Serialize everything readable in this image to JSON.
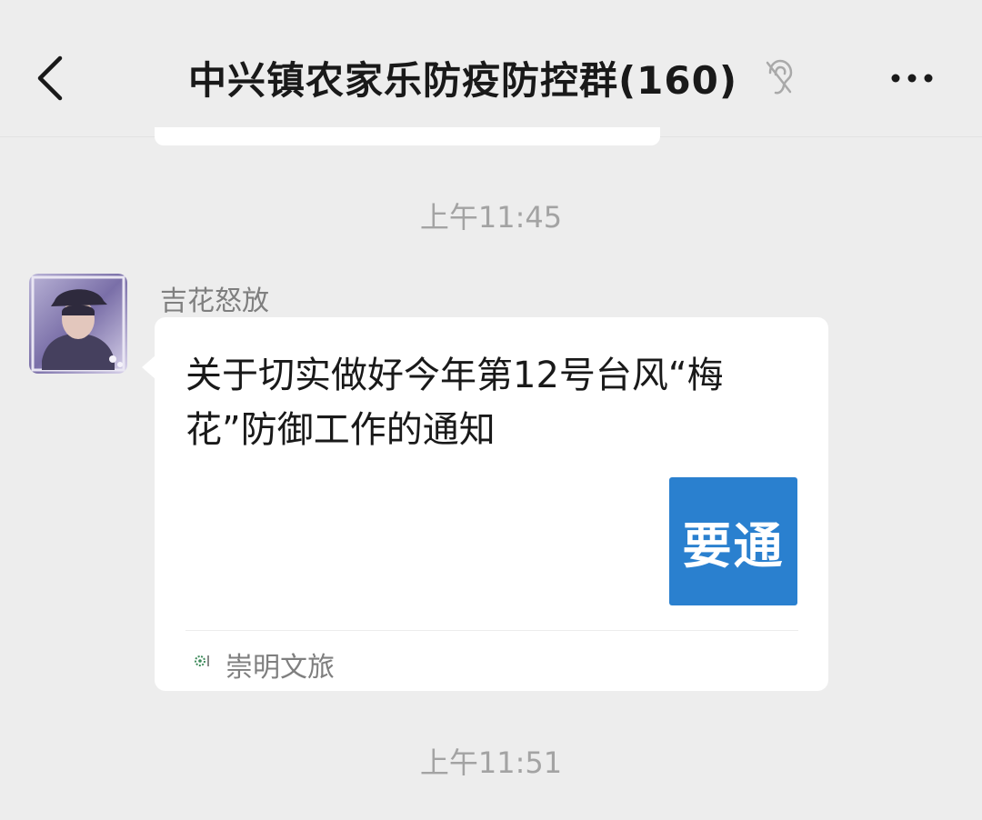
{
  "header": {
    "title": "中兴镇农家乐防疫防控群(160)",
    "back_icon": "chevron-left-icon",
    "mute_icon": "ear-icon",
    "more_icon": "more-horizontal-icon"
  },
  "messages": [
    {
      "type": "timestamp",
      "text": "上午11:45"
    },
    {
      "type": "link_card",
      "sender": "吉花怒放",
      "title": "关于切实做好今年第12号台风“梅花”防御工作的通知",
      "thumbnail_text": "要通",
      "source_name": "崇明文旅"
    },
    {
      "type": "timestamp",
      "text": "上午11:51"
    }
  ],
  "colors": {
    "background": "#ededed",
    "bubble": "#ffffff",
    "thumbnail": "#2a80cf",
    "secondary_text": "#7f7f7f"
  }
}
